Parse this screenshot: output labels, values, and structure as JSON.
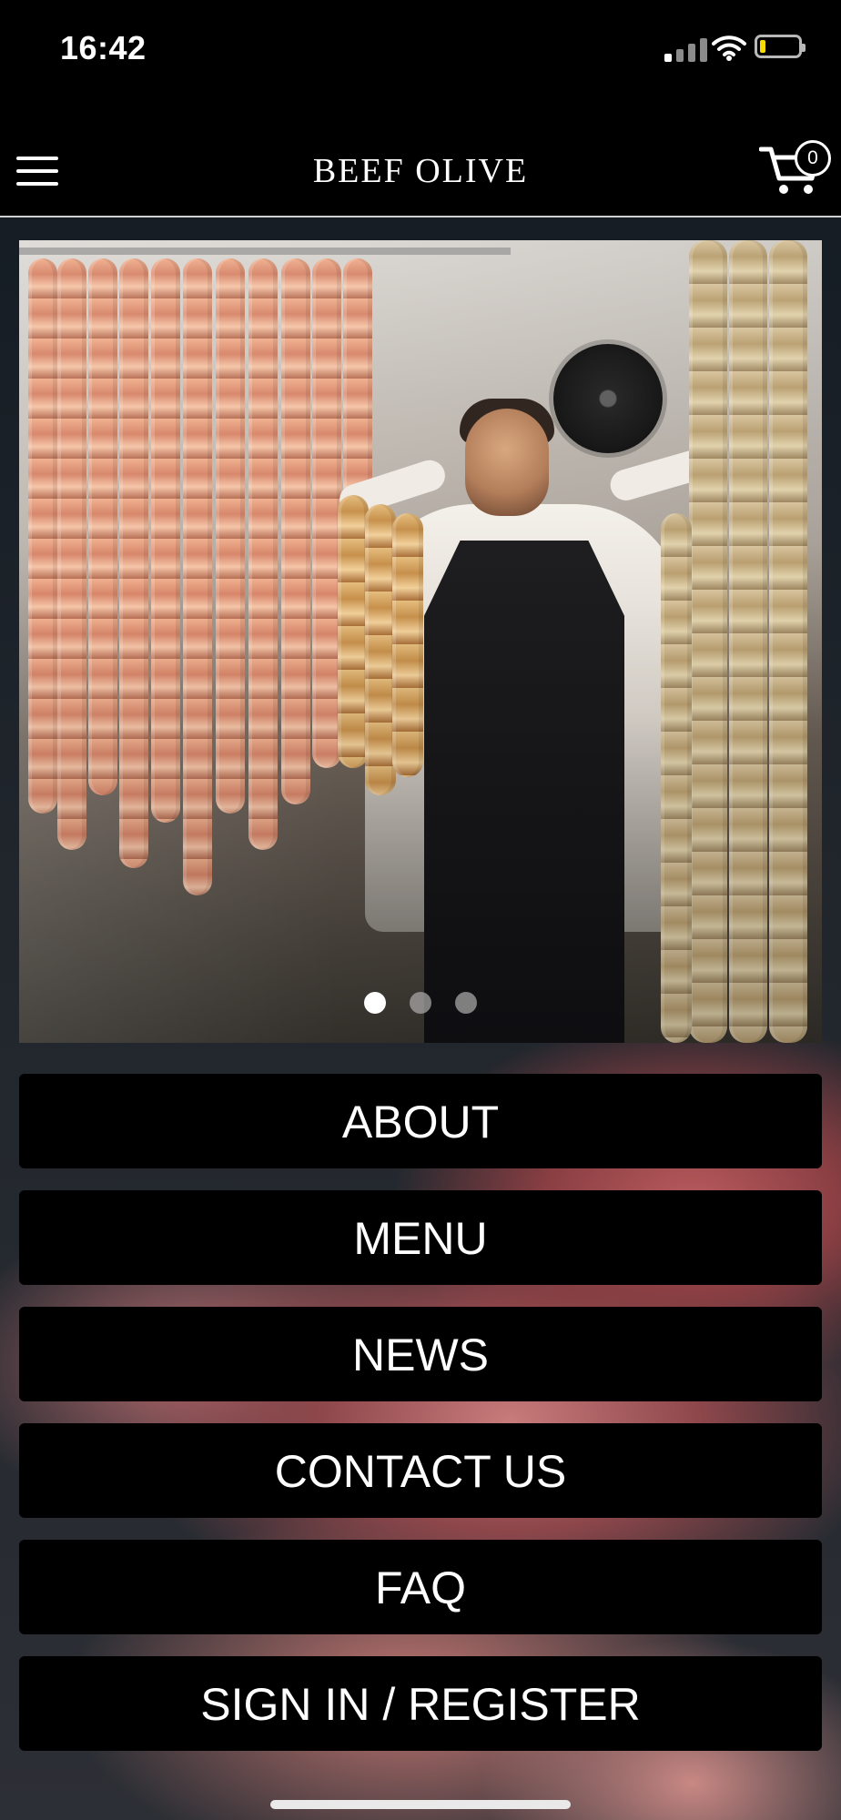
{
  "status_bar": {
    "time": "16:42",
    "signal_icon": "signal-icon",
    "wifi_icon": "wifi-icon",
    "battery_icon": "battery-icon",
    "battery_color": "#f6dc00"
  },
  "header": {
    "title": "BEEF OLIVE",
    "menu_icon": "hamburger-menu-icon",
    "cart_icon": "shopping-cart-icon",
    "cart_count": "0"
  },
  "carousel": {
    "slides": 3,
    "active_index": 0
  },
  "menu": {
    "items": [
      {
        "label": "ABOUT"
      },
      {
        "label": "MENU"
      },
      {
        "label": "NEWS"
      },
      {
        "label": "CONTACT US"
      },
      {
        "label": "FAQ"
      },
      {
        "label": "SIGN IN / REGISTER"
      }
    ]
  }
}
